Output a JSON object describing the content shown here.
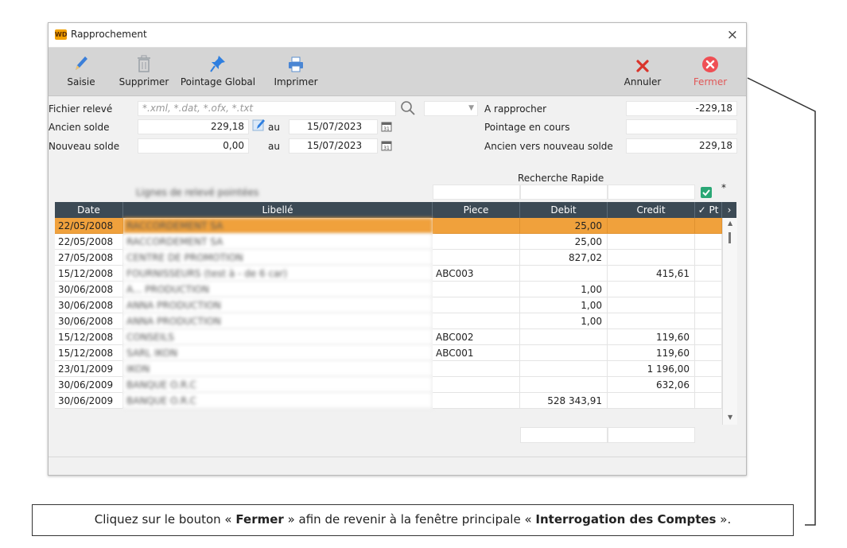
{
  "window": {
    "title": "Rapprochement",
    "app_icon_text": "WD",
    "close_glyph": "×"
  },
  "toolbar": {
    "saisie": "Saisie",
    "supprimer": "Supprimer",
    "pointage_global": "Pointage Global",
    "imprimer": "Imprimer",
    "annuler": "Annuler",
    "fermer": "Fermer"
  },
  "form": {
    "fichier_releve_label": "Fichier relevé",
    "fichier_releve_placeholder": "*.xml, *.dat, *.ofx, *.txt",
    "ancien_solde_label": "Ancien solde",
    "ancien_solde_value": "229,18",
    "nouveau_solde_label": "Nouveau solde",
    "nouveau_solde_value": "0,00",
    "au_label_1": "au",
    "au_label_2": "au",
    "date_1": "15/07/2023",
    "date_2": "15/07/2023",
    "a_rapprocher_label": "A rapprocher",
    "a_rapprocher_value": "-229,18",
    "pointage_label": "Pointage en cours",
    "pointage_value": "",
    "ancien_nouveau_label": "Ancien vers nouveau solde",
    "ancien_nouveau_value": "229,18",
    "recherche_label": "Recherche Rapide",
    "blurred_caption": "Lignes de relevé pointées"
  },
  "grid": {
    "headers": {
      "date": "Date",
      "libelle": "Libellé",
      "piece": "Piece",
      "debit": "Debit",
      "credit": "Credit",
      "pt": "Pt"
    },
    "rows": [
      {
        "date": "22/05/2008",
        "libelle": "RACCORDEMENT SA",
        "piece": "",
        "debit": "25,00",
        "credit": ""
      },
      {
        "date": "22/05/2008",
        "libelle": "RACCORDEMENT SA",
        "piece": "",
        "debit": "25,00",
        "credit": ""
      },
      {
        "date": "27/05/2008",
        "libelle": "CENTRE DE PROMOTION",
        "piece": "",
        "debit": "827,02",
        "credit": ""
      },
      {
        "date": "15/12/2008",
        "libelle": "FOURNISSEURS (test à - de 6 car)",
        "piece": "ABC003",
        "debit": "",
        "credit": "415,61"
      },
      {
        "date": "30/06/2008",
        "libelle": "A... PRODUCTION",
        "piece": "",
        "debit": "1,00",
        "credit": ""
      },
      {
        "date": "30/06/2008",
        "libelle": "ANNA PRODUCTION",
        "piece": "",
        "debit": "1,00",
        "credit": ""
      },
      {
        "date": "30/06/2008",
        "libelle": "ANNA PRODUCTION",
        "piece": "",
        "debit": "1,00",
        "credit": ""
      },
      {
        "date": "15/12/2008",
        "libelle": "CONSEILS",
        "piece": "ABC002",
        "debit": "",
        "credit": "119,60"
      },
      {
        "date": "15/12/2008",
        "libelle": "SARL IKON",
        "piece": "ABC001",
        "debit": "",
        "credit": "119,60"
      },
      {
        "date": "23/01/2009",
        "libelle": "IKON",
        "piece": "",
        "debit": "",
        "credit": "1 196,00"
      },
      {
        "date": "30/06/2009",
        "libelle": "BANQUE O.R.C",
        "piece": "",
        "debit": "",
        "credit": "632,06"
      },
      {
        "date": "30/06/2009",
        "libelle": "BANQUE O.R.C",
        "piece": "",
        "debit": "528 343,91",
        "credit": ""
      }
    ]
  },
  "callout": {
    "part1": "Cliquez sur le bouton « ",
    "bold1": "Fermer",
    "part2": " » afin de revenir à la fenêtre principale « ",
    "bold2": "Interrogation des Comptes",
    "part3": " »."
  },
  "colors": {
    "selected_row": "#f0a13c",
    "header_bg": "#3c4a55",
    "fermer": "#e05858",
    "annuler": "#d9342b"
  }
}
